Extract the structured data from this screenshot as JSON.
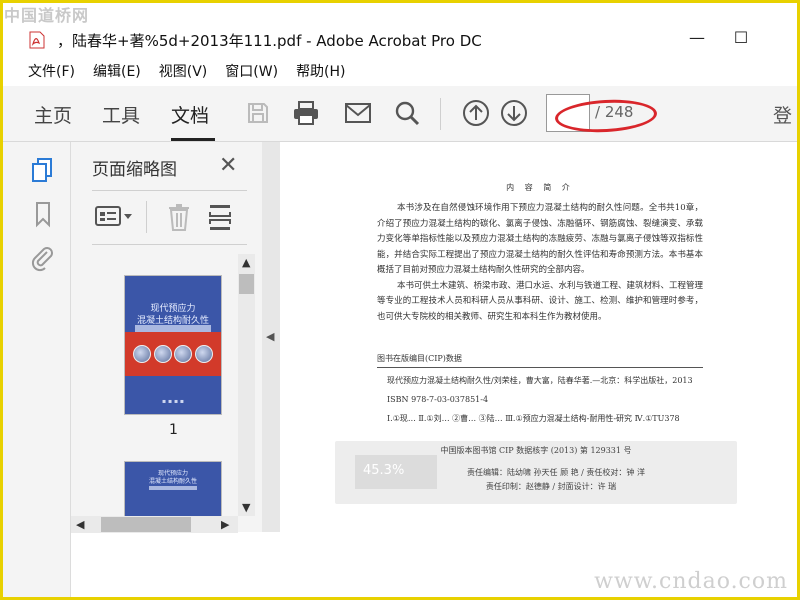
{
  "watermark": {
    "top": "中国道桥网",
    "bottom": "www.cndao.com"
  },
  "window": {
    "title": "，陆春华+著%5d+2013年111.pdf - Adobe Acrobat Pro DC",
    "minimize": "—",
    "maximize": "☐"
  },
  "menu": [
    "文件(F)",
    "编辑(E)",
    "视图(V)",
    "窗口(W)",
    "帮助(H)"
  ],
  "toolbar": {
    "tabs": [
      "主页",
      "工具",
      "文档"
    ],
    "active_tab": "文档",
    "page_current": "",
    "page_total": "/ 248",
    "login": "登"
  },
  "panel": {
    "title": "页面缩略图",
    "thumbnails": [
      {
        "page_label": "1",
        "cover_title": "现代预应力",
        "cover_title2": "混凝土结构耐久性"
      },
      {
        "page_label": "",
        "cover_title": "现代预应力",
        "cover_title2": "混凝土结构耐久性"
      }
    ]
  },
  "document": {
    "heading": "内 容 简 介",
    "paragraphs": [
      "本书涉及在自然侵蚀环境作用下预应力混凝土结构的耐久性问题。全书共10章，介绍了预应力混凝土结构的碳化、氯离子侵蚀、冻融循环、钢筋腐蚀、裂缝演变、承载力变化等单指标性能以及预应力混凝土结构的冻融疲劳、冻融与氯离子侵蚀等双指标性能，并结合实际工程提出了预应力混凝土结构的耐久性评估和寿命预测方法。本书基本概括了目前对预应力混凝土结构耐久性研究的全部内容。",
      "本书可供土木建筑、桥梁市政、港口水运、水利与铁道工程、建筑材料、工程管理等专业的工程技术人员和科研人员从事科研、设计、施工、检测、维护和管理时参考，也可供大专院校的相关教师、研究生和本科生作为教材使用。"
    ],
    "cip_title": "图书在版编目(CIP)数据",
    "cip_lines": [
      "现代预应力混凝土结构耐久性/刘荣桂，曹大富，陆春华著.—北京：科学出版社，2013",
      "ISBN 978-7-03-037851-4",
      "Ⅰ.①现… Ⅱ.①刘… ②曹… ③陆… Ⅲ.①预应力混凝土结构-耐用性-研究 Ⅳ.①TU378"
    ],
    "cip_number": "中国版本图书馆 CIP 数据核字 (2013) 第 129331 号",
    "editors": "责任编辑：陆幼啸   孙天任   顾   艳 / 责任校对：钟   洋",
    "printer": "责任印制：赵德静 / 封面设计：许   瑞"
  },
  "progress": {
    "percent_label": "45.3%",
    "percent": 45.3
  }
}
